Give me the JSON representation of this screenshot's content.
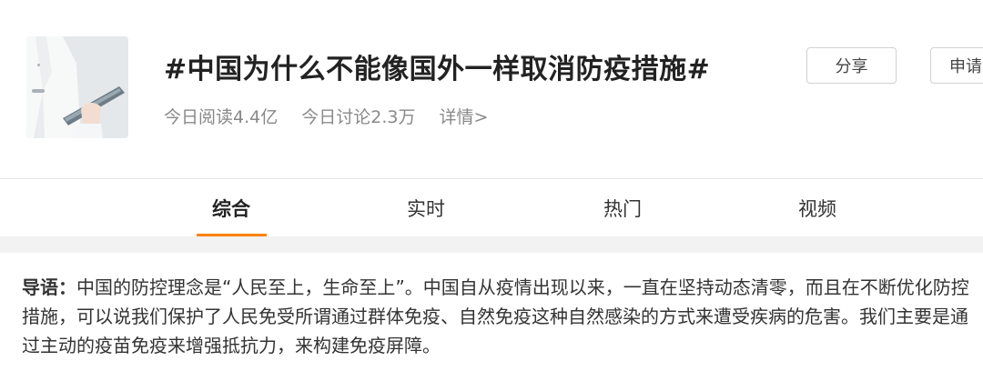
{
  "topic": {
    "title": "#中国为什么不能像国外一样取消防疫措施#",
    "read_today": "今日阅读4.4亿",
    "discuss_today": "今日讨论2.3万",
    "details_link": "详情>"
  },
  "actions": {
    "share_label": "分享",
    "apply_label": "申请"
  },
  "tabs": [
    {
      "label": "综合",
      "active": true
    },
    {
      "label": "实时",
      "active": false
    },
    {
      "label": "热门",
      "active": false
    },
    {
      "label": "视频",
      "active": false
    }
  ],
  "intro": {
    "label": "导语：",
    "text": "中国的防控理念是“人民至上，生命至上”。中国自从疫情出现以来，一直在坚持动态清零，而且在不断优化防控措施，可以说我们保护了人民免受所谓通过群体免疫、自然免疫这种自然感染的方式来遭受疾病的危害。我们主要是通过主动的疫苗免疫来增强抵抗力，来构建免疫屏障。"
  },
  "colors": {
    "accent": "#ff8200",
    "title": "#222222",
    "muted": "#888888",
    "divider": "#e6e6e6",
    "gap": "#f2f2f2"
  }
}
